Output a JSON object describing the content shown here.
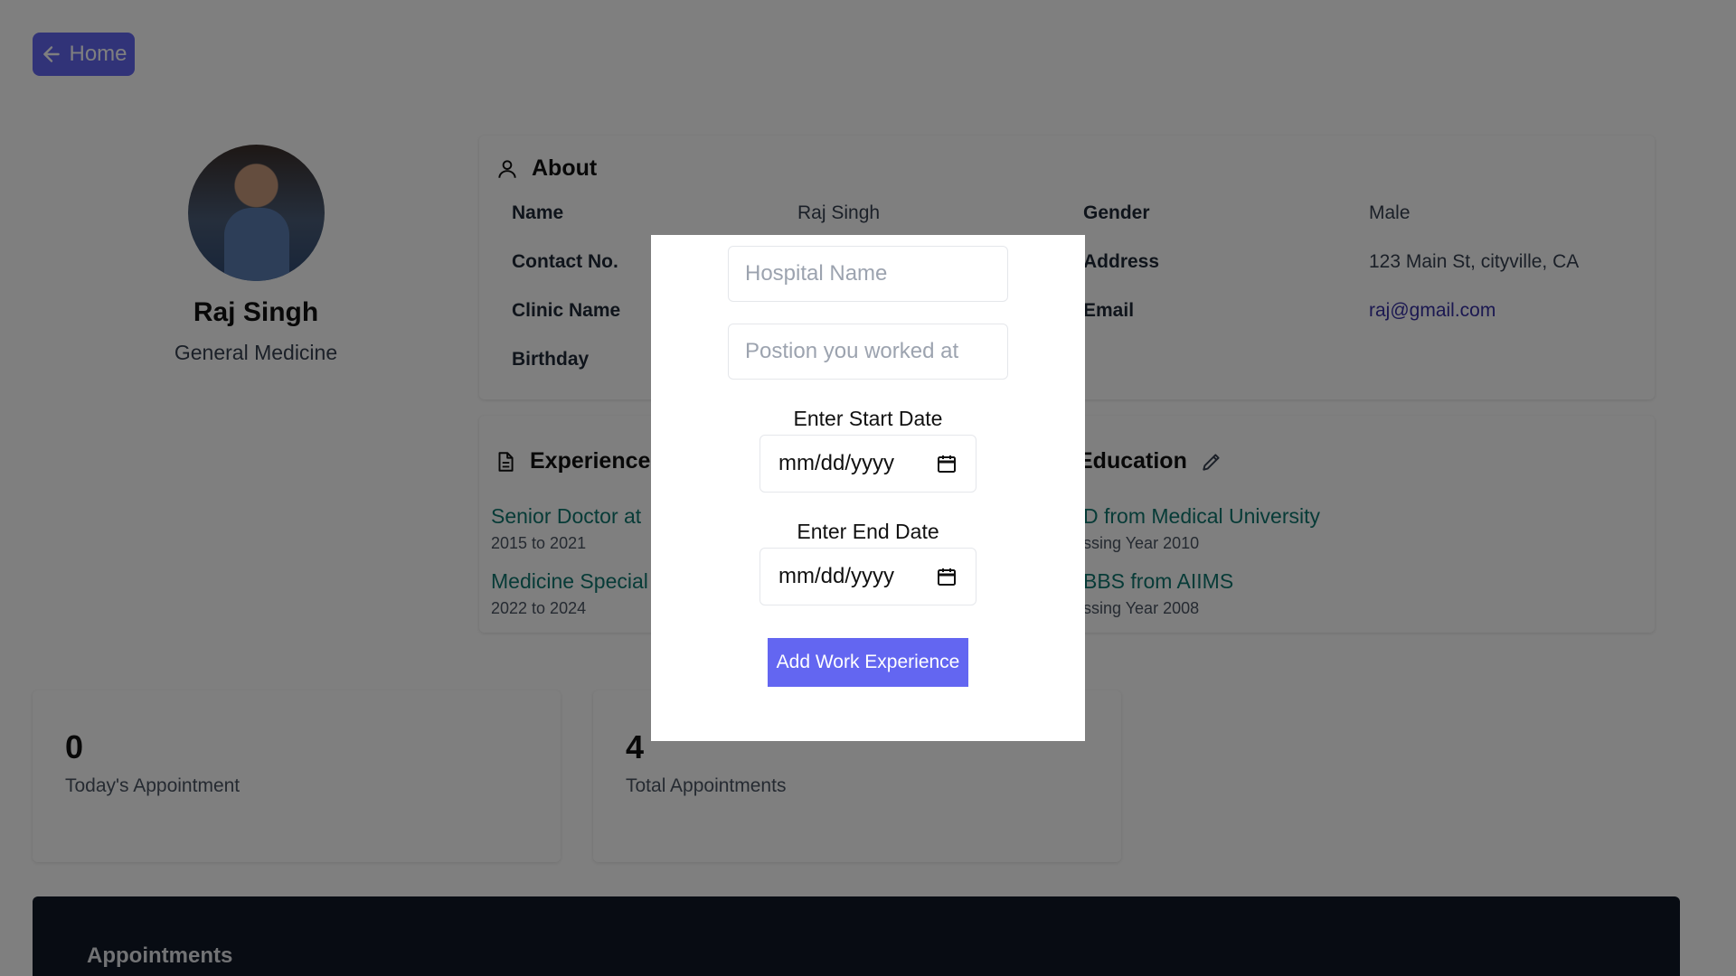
{
  "nav": {
    "home_label": "Home"
  },
  "profile": {
    "name": "Raj Singh",
    "specialty": "General Medicine"
  },
  "about": {
    "title": "About",
    "fields": [
      {
        "label": "Name",
        "value": "Raj Singh"
      },
      {
        "label": "Gender",
        "value": "Male"
      },
      {
        "label": "Contact No.",
        "value": ""
      },
      {
        "label": "Address",
        "value": "123 Main St, cityville, CA"
      },
      {
        "label": "Clinic Name",
        "value": ""
      },
      {
        "label": "Email",
        "value": "raj@gmail.com"
      },
      {
        "label": "Birthday",
        "value": ""
      }
    ]
  },
  "experience": {
    "title": "Experience",
    "items": [
      {
        "title": "Senior Doctor at",
        "period": "2015 to 2021"
      },
      {
        "title": "Medicine Special",
        "period": "2022 to 2024"
      }
    ]
  },
  "education": {
    "title": "Education",
    "items": [
      {
        "title": "D from Medical University",
        "year": "ssing Year 2010"
      },
      {
        "title": "BBS from AIIMS",
        "year": "ssing Year 2008"
      }
    ]
  },
  "stats": [
    {
      "value": "0",
      "label": "Today's Appointment"
    },
    {
      "value": "4",
      "label": "Total Appointments"
    }
  ],
  "appointments": {
    "title": "Appointments"
  },
  "modal": {
    "hospital_placeholder": "Hospital Name",
    "position_placeholder": "Postion you worked at",
    "start_label": "Enter Start Date",
    "start_value": "mm/dd/yyyy",
    "end_label": "Enter End Date",
    "end_value": "mm/dd/yyyy",
    "submit_label": "Add Work Experience"
  }
}
